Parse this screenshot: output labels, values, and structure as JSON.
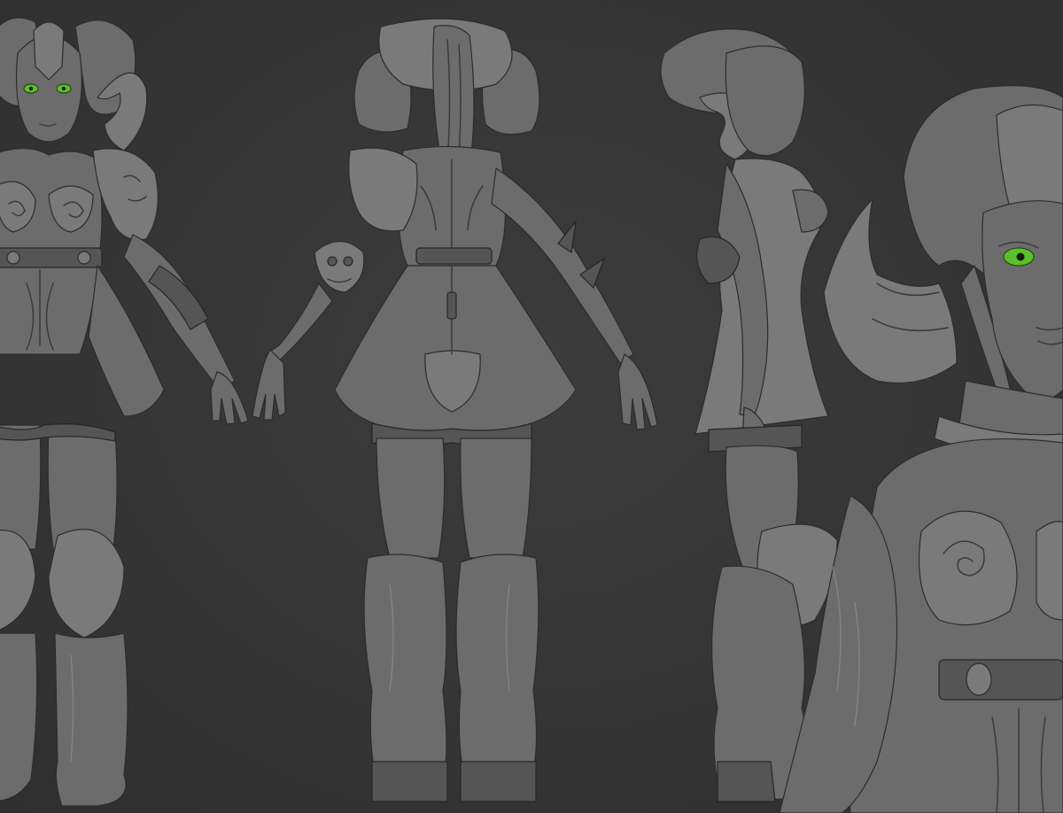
{
  "scene": {
    "background_color": "#363636",
    "clay_color": "#6c6c6c",
    "eye_color": "#5cc02a"
  },
  "views": [
    {
      "name": "front"
    },
    {
      "name": "back"
    },
    {
      "name": "side"
    },
    {
      "name": "closeup"
    }
  ]
}
